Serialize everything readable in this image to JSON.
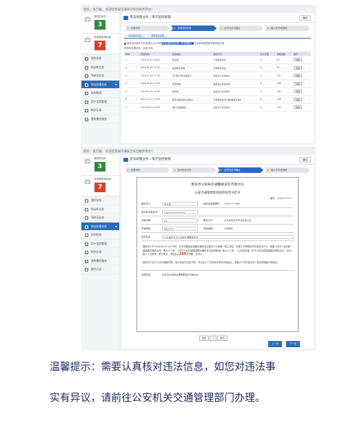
{
  "screenshot1": {
    "welcome": "您好，张万顺。 欢迎您登录交通安全综合服务平台！",
    "sidebar": {
      "card1_label": "我的机动车",
      "card1_count": "3",
      "card2_label": "待处理违章信息",
      "card2_count": "7",
      "nav": [
        "我的业务",
        "机动车业务",
        "驾驶证业务",
        "违法处理业务",
        "告知短信",
        "用户信息管理",
        "网办记录",
        "我的便民服务"
      ]
    },
    "header": {
      "title": "违法处理业务",
      "crumb": "电子监控处理",
      "back": "返回"
    },
    "steps": [
      "1、查看须知",
      "2、选择违法记录",
      "3、处罚决定书确认",
      "4、确认并完成缴款"
    ],
    "subtabs": [
      "本地违法记录",
      "异地违法记录"
    ],
    "notice_prefix": "请在本页面中可以处理七日以内的",
    "notice_highlight": "待处理违法记录（可处理的）",
    "notice_suffix": "以及本年度罚款未缴纳的记录",
    "filter": "按违法处理状态：全部  本地",
    "columns": [
      "序号",
      "违法时间",
      "违法地点",
      "违法行为",
      "记分分数",
      "罚款金额",
      "操作"
    ],
    "rows": [
      [
        "1",
        "2016-06-22 09:39",
        "青岛路",
        "不按规定停车",
        "0",
        "50",
        "查看"
      ],
      [
        "2",
        "2016-01-24 15:35",
        "金鼎路北侧路",
        "不按规定停车",
        "0",
        "50",
        "查看"
      ],
      [
        "3",
        "2016-01-24 17:00",
        "五行路与青岛路路口",
        "违反禁令标志指示",
        "3",
        "200",
        "查看"
      ],
      [
        "4",
        "2016-01-24 17:09",
        "香港中路",
        "违反禁止标线指示",
        "0",
        "200",
        "查看"
      ],
      [
        "5",
        "2016-01-24 13:56",
        "延安路",
        "违反禁令标志指示",
        "0",
        "100",
        "查看"
      ],
      [
        "6",
        "2015-12-11 11:26",
        "重庆中路和鞍山路路口",
        "不按规定车道行驶/遇有交通灯",
        "3",
        "100",
        "查看"
      ],
      [
        "7",
        "2015-08-19 12:09",
        "福州北路路路口",
        "违反禁令标志指示",
        "0",
        "100",
        "查看"
      ]
    ]
  },
  "screenshot2": {
    "welcome": "您好，张万顺。 欢迎您登录交通安全综合服务平台！",
    "sidebar": {
      "card1_label": "我的机动车",
      "card1_count": "3",
      "card2_label": "待处理违章信息",
      "card2_count": "7",
      "nav": [
        "我的业务",
        "机动车业务",
        "驾驶证业务",
        "违法处理业务",
        "告知短信",
        "用户信息管理",
        "网办记录",
        "我的便民服务",
        "操作日志"
      ]
    },
    "header": {
      "title": "违法处理业务",
      "crumb": "电子监控处理",
      "back": "返回"
    },
    "steps": [
      "1、查看须知",
      "2、选择违法记录",
      "3、处罚决定书确认",
      "4、确认并完成缴款"
    ],
    "doc": {
      "agency": "青岛市公安局交通警察支队市南大队",
      "title": "公安交通管理简易程序处罚决定书",
      "number": "编号：3702********",
      "fields": [
        [
          "被处罚人：",
          "张万顺",
          "驾驶证档案编号：",
          "3702****1565"
        ],
        [
          "机动车驾驶证号：",
          "3707************5",
          "",
          ""
        ],
        [
          "车辆号牌：",
          "C1",
          "联系方式：",
          "山东省青岛市市北区某小区"
        ],
        [
          "车辆类型：",
          "鲁B7****",
          "车辆品牌：",
          "小型轿车"
        ]
      ],
      "org_label": "执罚机关：",
      "org_value": "山东省青岛市公安局交通警察支队",
      "decision_a": "被处罚人于2016-06-22 09:39时，在青岛路违反道路交通安全法第五十六条第一款之规定，实施了不按规定停车的违法行为，依据《中华人民共和国道路交通安全法》第九十三条、《中华人民共和国道路交通安全法实施条例》第六十三条、《山东省实施〈中华人民共和国道路交通安全法〉办法》第八十五条第一款之规定，决定处以",
      "decision_fine": "100",
      "decision_b": "元罚款，记0分。",
      "rights": "被处罚人应于15日内缴纳罚款。如对本处罚决定不服，可以在六十日内依法申请行政复议，或者六个月内依法向人民法院提起行政诉讼。",
      "sign_label": "处理机关：",
      "sign_value": "青岛市公安局交通警察支队市南大队"
    },
    "pager": [
      "首页",
      "1",
      "尾页"
    ],
    "prev": "上一步",
    "next": "下一步"
  },
  "tip_line1": "温馨提示：需要认真核对违法信息，如您对违法事",
  "tip_line2": "实有异议，请前往公安机关交通管理部门办理。"
}
